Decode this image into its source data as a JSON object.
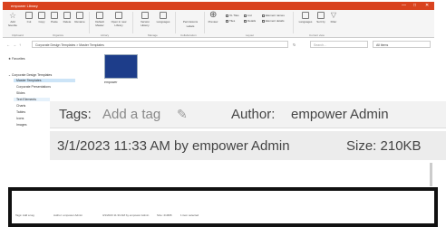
{
  "window": {
    "title": "empower Library",
    "controls": [
      "—",
      "□",
      "✕"
    ]
  },
  "ribbon": {
    "buttons": [
      {
        "label": "Add favorite",
        "icon": "star-icon"
      },
      {
        "label": "Cut",
        "icon": "cut-icon"
      },
      {
        "label": "Copy",
        "icon": "copy-icon"
      },
      {
        "label": "Paste",
        "icon": "paste-icon"
      },
      {
        "label": "Delete",
        "icon": "delete-icon"
      },
      {
        "label": "Rename",
        "icon": "rename-icon"
      },
      {
        "label": "Default Master",
        "icon": "master-icon"
      },
      {
        "label": "Open in new Library",
        "icon": "open-icon"
      },
      {
        "label": "Version History",
        "icon": "history-icon"
      },
      {
        "label": "Languages",
        "icon": "languages-icon"
      },
      {
        "label": "Permissions",
        "icon": "permissions-icon"
      },
      {
        "label": "Labels",
        "icon": "labels-icon"
      },
      {
        "label": "Preview",
        "icon": "zoom-icon"
      }
    ],
    "groups": [
      "Clipboard",
      "Organize",
      "Library",
      "Manage",
      "Collaboration",
      "Layout",
      "Current view"
    ],
    "layout_options": {
      "xl_tiles": "XL Tiles",
      "tiles": "Tiles",
      "list": "List",
      "details": "Details",
      "element_names": "Element names",
      "element_details": "Element details"
    },
    "view_buttons": [
      {
        "label": "Languages",
        "icon": "languages-icon"
      },
      {
        "label": "Sort by",
        "icon": "sort-icon"
      },
      {
        "label": "Filter",
        "icon": "filter-icon"
      }
    ]
  },
  "address": {
    "path": "Corporate Design Templates  >  Master Templates",
    "search_placeholder": "Search...",
    "scope": "All items"
  },
  "tree": {
    "favorites": "Favorites",
    "root": "Corporate Design Templates",
    "items": [
      "Master Templates",
      "Corporate Presentations",
      "Slides",
      "Text Elements",
      "Charts",
      "Tables",
      "Icons",
      "Images"
    ]
  },
  "content": {
    "thumbnail_label": "empower"
  },
  "details": {
    "tags_label": "Tags:",
    "tags_placeholder": "Add a tag",
    "author_label": "Author:",
    "author_value": "empower Admin",
    "modified": "3/1/2023 11:33 AM by empower Admin",
    "size": "Size: 210KB"
  },
  "status_bar": {
    "tags": "Tags: Add a tag",
    "author": "Author: empower Admin",
    "modified": "3/1/2023 11:33 AM by empower Admin",
    "size": "Size: 210KB",
    "selection": "1 item selected"
  },
  "colors": {
    "title_bar": "#d9431f",
    "selection": "#cce4f7",
    "thumbnail": "#1d3d8a"
  }
}
